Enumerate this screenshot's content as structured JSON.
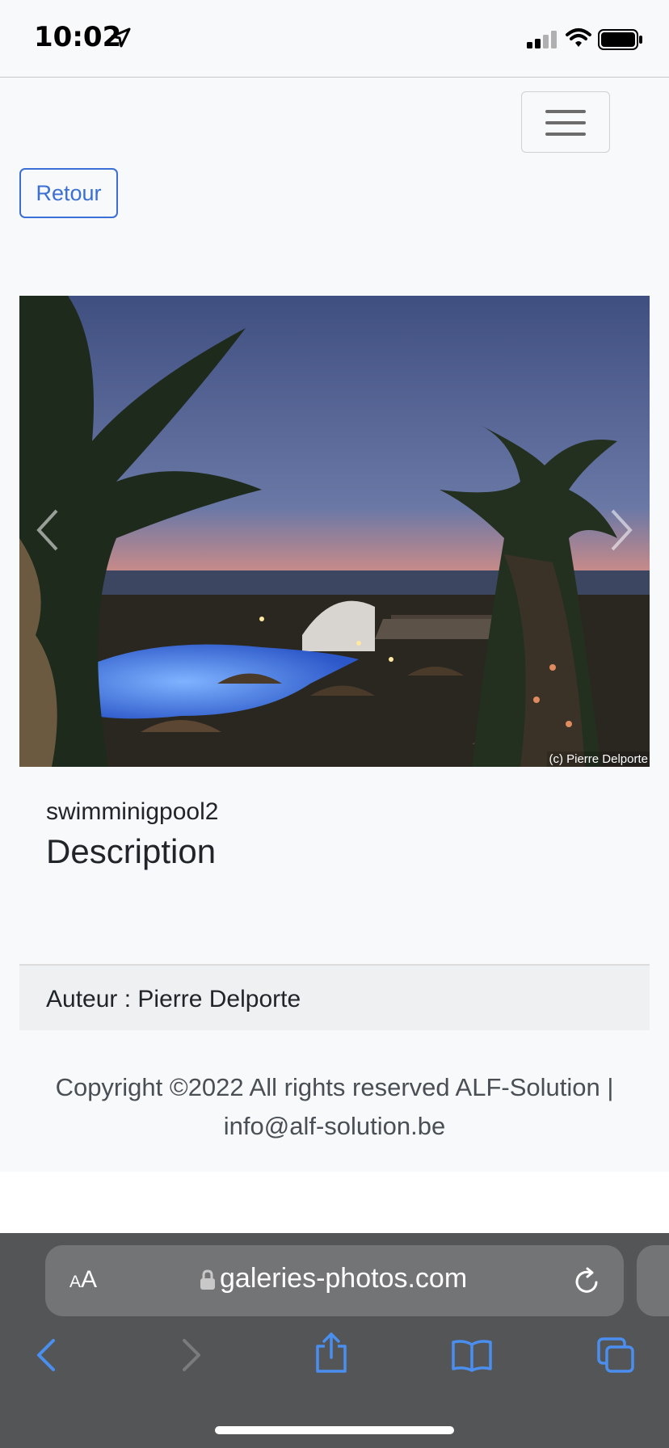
{
  "status_bar": {
    "time": "10:02"
  },
  "navbar": {
    "toggler_icon": "hamburger-menu-icon"
  },
  "back_button": {
    "label": "Retour"
  },
  "carousel": {
    "image_credit": "(c) Pierre Delporte",
    "prev_icon": "chevron-left-icon",
    "next_icon": "chevron-right-icon"
  },
  "photo": {
    "title": "swimminigpool2",
    "description_heading": "Description",
    "author": "Auteur : Pierre Delporte"
  },
  "footer": {
    "copyright_line1": "Copyright ©2022 All rights reserved ALF-Solution |",
    "copyright_line2": "info@alf-solution.be"
  },
  "browser": {
    "text_size_label_small": "A",
    "text_size_label_large": "A",
    "url": "galeries-photos.com"
  },
  "colors": {
    "accent": "#3b6fd6",
    "safari_bar": "#545556",
    "ios_blue": "#4a8ff0"
  }
}
